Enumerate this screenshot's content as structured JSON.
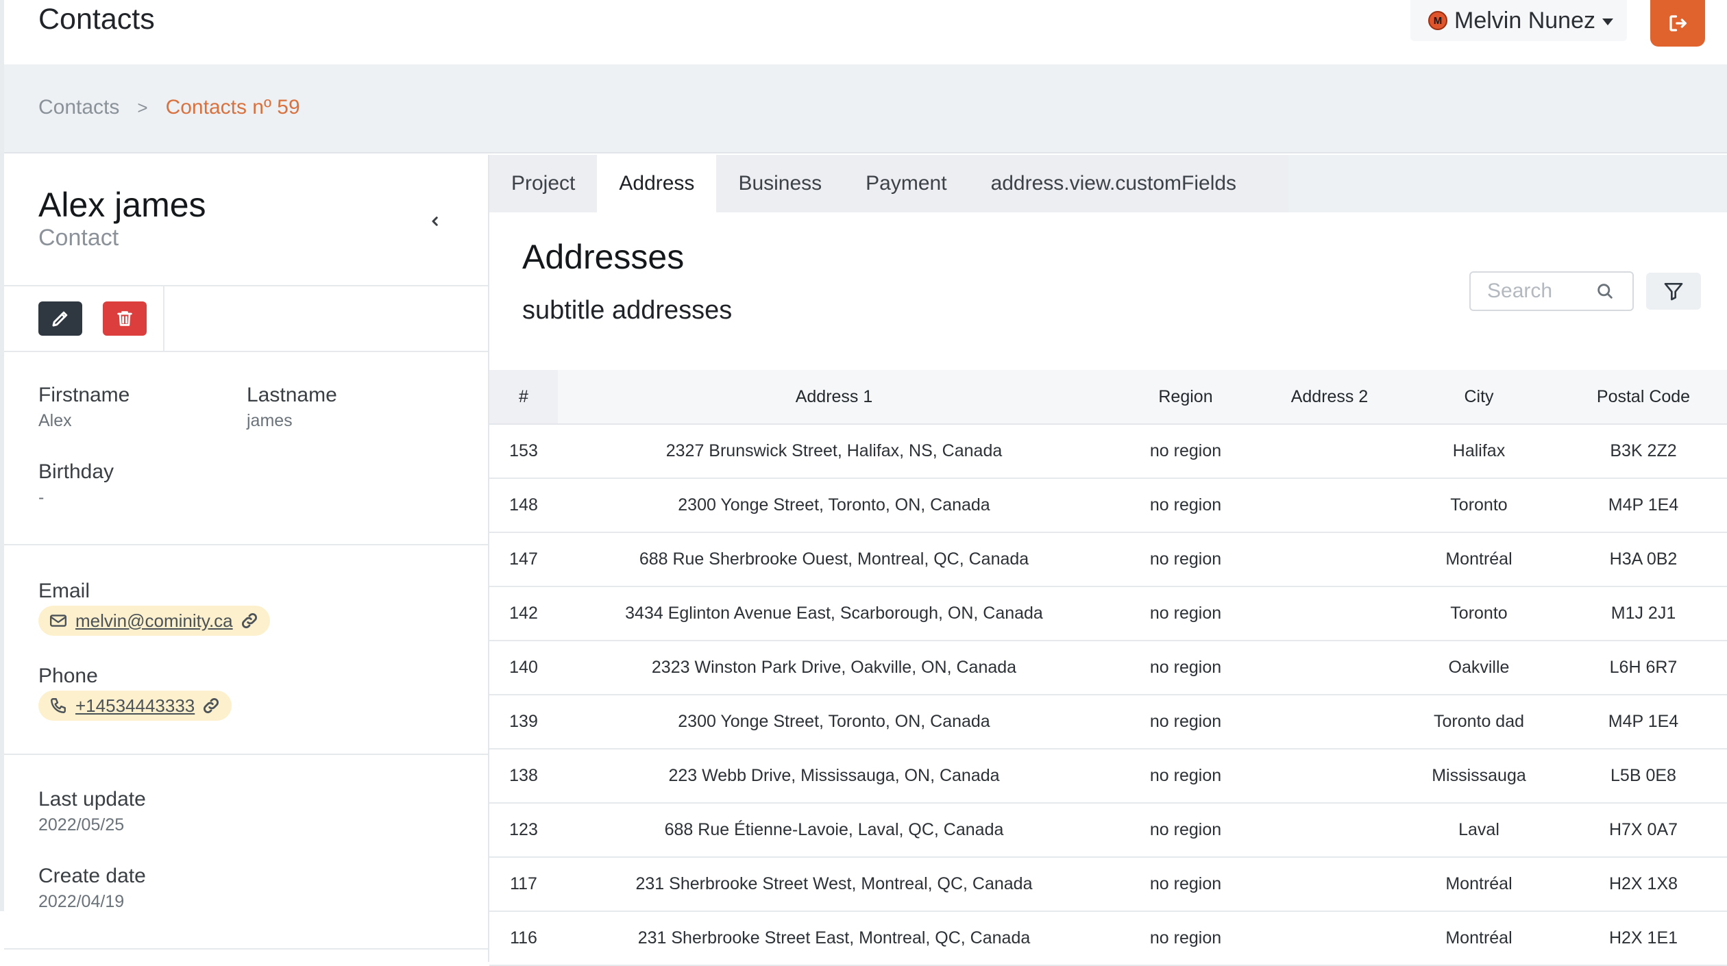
{
  "header": {
    "title": "Contacts",
    "user": {
      "initial": "M",
      "name": "Melvin Nunez"
    }
  },
  "breadcrumb": {
    "root": "Contacts",
    "separator": ">",
    "current": "Contacts nº 59"
  },
  "contact": {
    "name": "Alex james",
    "role": "Contact",
    "firstname_label": "Firstname",
    "firstname": "Alex",
    "lastname_label": "Lastname",
    "lastname": "james",
    "birthday_label": "Birthday",
    "birthday": "-",
    "email_label": "Email",
    "email": "melvin@cominity.ca",
    "phone_label": "Phone",
    "phone": "+14534443333",
    "last_update_label": "Last update",
    "last_update": "2022/05/25",
    "create_date_label": "Create date",
    "create_date": "2022/04/19"
  },
  "tabs": [
    "Project",
    "Address",
    "Business",
    "Payment",
    "address.view.customFields"
  ],
  "active_tab": "Address",
  "addresses": {
    "title": "Addresses",
    "subtitle": "subtitle addresses",
    "search_placeholder": "Search",
    "columns": [
      "#",
      "Address 1",
      "Region",
      "Address 2",
      "City",
      "Postal Code"
    ],
    "rows": [
      [
        "153",
        "2327 Brunswick Street, Halifax, NS, Canada",
        "no region",
        "",
        "Halifax",
        "B3K 2Z2"
      ],
      [
        "148",
        "2300 Yonge Street, Toronto, ON, Canada",
        "no region",
        "",
        "Toronto",
        "M4P 1E4"
      ],
      [
        "147",
        "688 Rue Sherbrooke Ouest, Montreal, QC, Canada",
        "no region",
        "",
        "Montréal",
        "H3A 0B2"
      ],
      [
        "142",
        "3434 Eglinton Avenue East, Scarborough, ON, Canada",
        "no region",
        "",
        "Toronto",
        "M1J 2J1"
      ],
      [
        "140",
        "2323 Winston Park Drive, Oakville, ON, Canada",
        "no region",
        "",
        "Oakville",
        "L6H 6R7"
      ],
      [
        "139",
        "2300 Yonge Street, Toronto, ON, Canada",
        "no region",
        "",
        "Toronto dad",
        "M4P 1E4"
      ],
      [
        "138",
        "223 Webb Drive, Mississauga, ON, Canada",
        "no region",
        "",
        "Mississauga",
        "L5B 0E8"
      ],
      [
        "123",
        "688 Rue Étienne-Lavoie, Laval, QC, Canada",
        "no region",
        "",
        "Laval",
        "H7X 0A7"
      ],
      [
        "117",
        "231 Sherbrooke Street West, Montreal, QC, Canada",
        "no region",
        "",
        "Montréal",
        "H2X 1X8"
      ],
      [
        "116",
        "231 Sherbrooke Street East, Montreal, QC, Canada",
        "no region",
        "",
        "Montréal",
        "H2X 1E1"
      ]
    ]
  },
  "colors": {
    "accent": "#e0632e",
    "breadcrumb_current": "#d9713e",
    "delete": "#dc3d3d",
    "edit": "#2f3840",
    "pill": "#fdf0cc"
  },
  "icons": [
    "caret-down-icon",
    "logout-icon",
    "chevron-left-icon",
    "pencil-icon",
    "trash-icon",
    "mail-icon",
    "link-icon",
    "phone-icon",
    "search-icon",
    "filter-icon"
  ]
}
